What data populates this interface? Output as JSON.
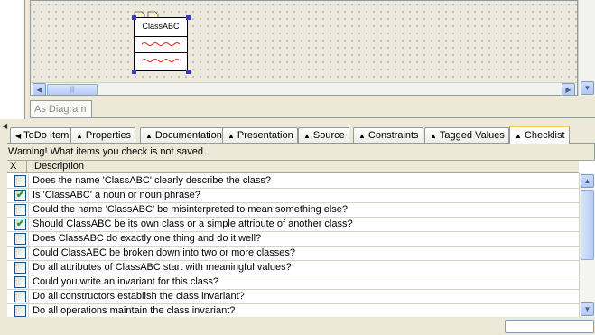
{
  "diagram": {
    "class_name": "ClassABC",
    "view_tab_label": "As Diagram",
    "h_thumb_grip": "|||",
    "scroll_left_icon": "chevron-left-icon",
    "scroll_right_icon": "chevron-right-icon",
    "scroll_down_icon": "chevron-down-icon"
  },
  "tabs": [
    {
      "label": "ToDo Item",
      "arrow": "◀"
    },
    {
      "label": "Properties",
      "arrow": "▲"
    },
    {
      "label": "Documentation",
      "arrow": "▲"
    },
    {
      "label": "Presentation",
      "arrow": "▲"
    },
    {
      "label": "Source",
      "arrow": "▲"
    },
    {
      "label": "Constraints",
      "arrow": "▲"
    },
    {
      "label": "Tagged Values",
      "arrow": "▲"
    },
    {
      "label": "Checklist",
      "arrow": "▲",
      "active": true
    }
  ],
  "checklist": {
    "warning": "Warning! What items you check is not saved.",
    "columns": {
      "x": "X",
      "description": "Description"
    },
    "items": [
      {
        "text": "Does the name 'ClassABC' clearly describe the class?",
        "checked": false
      },
      {
        "text": "Is 'ClassABC' a noun or noun phrase?",
        "checked": true
      },
      {
        "text": "Could the name 'ClassABC' be misinterpreted to mean something else?",
        "checked": false
      },
      {
        "text": "Should ClassABC be its own class or a simple attribute of another class?",
        "checked": true
      },
      {
        "text": "Does ClassABC do exactly one thing and do it well?",
        "checked": false
      },
      {
        "text": "Could ClassABC be broken down into two or more classes?",
        "checked": false
      },
      {
        "text": "Do all attributes of ClassABC start with meaningful values?",
        "checked": false
      },
      {
        "text": "Could you write an invariant for this class?",
        "checked": false
      },
      {
        "text": "Do all constructors establish the class invariant?",
        "checked": false
      },
      {
        "text": "Do all operations maintain the class invariant?",
        "checked": false
      }
    ]
  },
  "colors": {
    "active_tab_accent": "#ffc83c",
    "check_mark": "#21a121"
  }
}
